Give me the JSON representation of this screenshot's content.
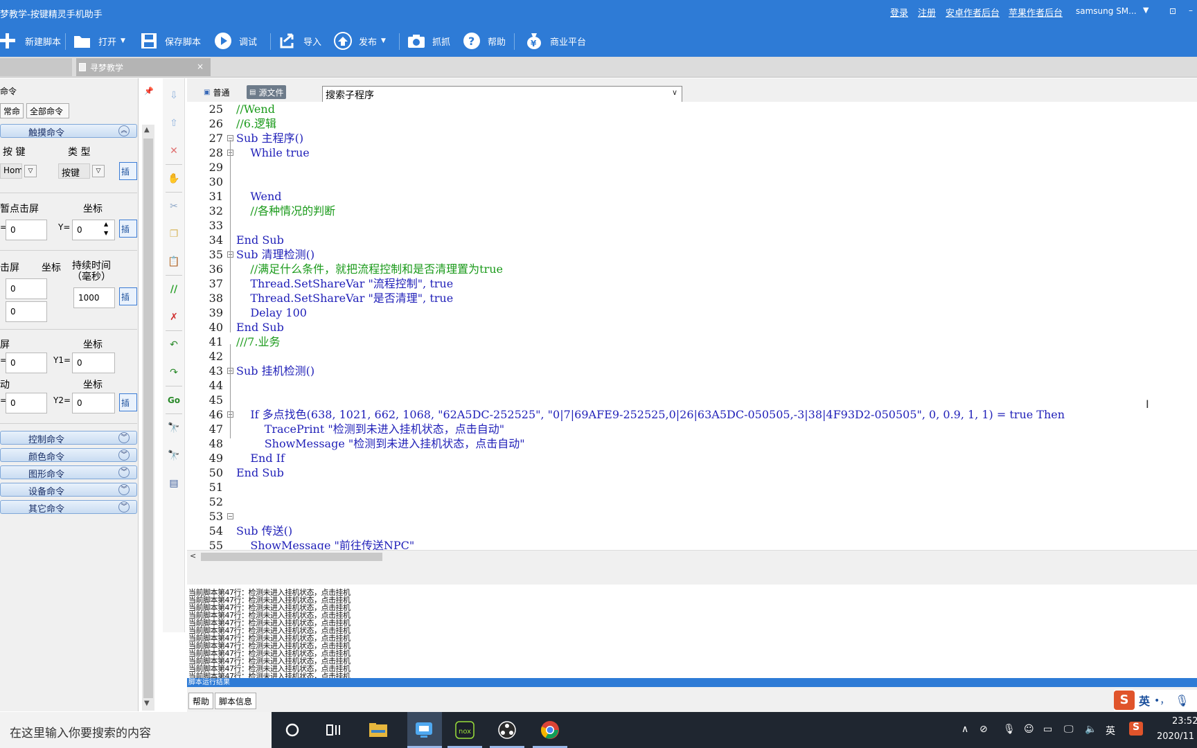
{
  "window": {
    "title": "梦教学-按键精灵手机助手",
    "links": [
      "登录",
      "注册",
      "安卓作者后台",
      "苹果作者后台"
    ],
    "device": "samsung  SM...",
    "win_btn1": "⊡",
    "win_btn2": "–"
  },
  "toolbar": {
    "new_script": "新建脚本",
    "open": "打开",
    "save_script": "保存脚本",
    "debug": "调试",
    "import": "导入",
    "publish": "发布",
    "capture": "抓抓",
    "help": "帮助",
    "business": "商业平台"
  },
  "tabs": {
    "doc_tab": "寻梦教学",
    "doc_close": "×"
  },
  "left_panel": {
    "title": "命令",
    "pin": "📌",
    "tab_common": "常命令",
    "tab_all": "全部命令",
    "touch_cat": "触摸命令",
    "key_label": "按 键",
    "type_label": "类 型",
    "key_value": "Home",
    "type_value": "按键",
    "tap_label": "暂点击屏",
    "coord_label": "坐标",
    "x_value": "0",
    "y_label": "Y=",
    "y_value": "0",
    "press_label": "击屏",
    "press_coord": "坐标",
    "duration_label": "持续时间（毫秒）",
    "press_x": "0",
    "press_y": "0",
    "duration_value": "1000",
    "swipe_label": "屏",
    "swipe_coord": "坐标",
    "swipe_x1": "0",
    "y1_label": "Y1=",
    "swipe_y1": "0",
    "move_label": "动",
    "move_coord": "坐标",
    "swipe_x2": "0",
    "y2_label": "Y2=",
    "swipe_y2": "0",
    "insert_btn": "插",
    "eq": "=",
    "categories": [
      "控制命令",
      "颜色命令",
      "图形命令",
      "设备命令",
      "其它命令"
    ]
  },
  "editor": {
    "mode_normal": "普通",
    "mode_source": "源文件",
    "search_placeholder": "搜索子程序",
    "lines": [
      {
        "n": "25",
        "text": "//Wend"
      },
      {
        "n": "26",
        "text": "//6.逻辑"
      },
      {
        "n": "27",
        "text": "Sub 主程序()"
      },
      {
        "n": "28",
        "text": "    While true"
      },
      {
        "n": "29",
        "text": ""
      },
      {
        "n": "30",
        "text": ""
      },
      {
        "n": "31",
        "text": "    Wend"
      },
      {
        "n": "32",
        "text": "    //各种情况的判断"
      },
      {
        "n": "33",
        "text": ""
      },
      {
        "n": "34",
        "text": "End Sub"
      },
      {
        "n": "35",
        "text": "Sub 清理检测()"
      },
      {
        "n": "36",
        "text": "    //满足什么条件，就把流程控制和是否清理置为true"
      },
      {
        "n": "37",
        "text": "    Thread.SetShareVar \"流程控制\", true"
      },
      {
        "n": "38",
        "text": "    Thread.SetShareVar \"是否清理\", true"
      },
      {
        "n": "39",
        "text": "    Delay 100"
      },
      {
        "n": "40",
        "text": "End Sub"
      },
      {
        "n": "41",
        "text": "///7.业务"
      },
      {
        "n": "42",
        "text": ""
      },
      {
        "n": "43",
        "text": "Sub 挂机检测()"
      },
      {
        "n": "44",
        "text": ""
      },
      {
        "n": "45",
        "text": ""
      },
      {
        "n": "46",
        "text": "    If 多点找色(638, 1021, 662, 1068, \"62A5DC-252525\", \"0|7|69AFE9-252525,0|26|63A5DC-050505,-3|38|4F93D2-050505\", 0, 0.9, 1, 1) = true Then"
      },
      {
        "n": "47",
        "text": "        TracePrint \"检测到未进入挂机状态，点击自动\""
      },
      {
        "n": "48",
        "text": "        ShowMessage \"检测到未进入挂机状态，点击自动\""
      },
      {
        "n": "49",
        "text": "    End If"
      },
      {
        "n": "50",
        "text": "End Sub"
      },
      {
        "n": "51",
        "text": ""
      },
      {
        "n": "52",
        "text": ""
      },
      {
        "n": "53",
        "text": ""
      },
      {
        "n": "54",
        "text": "Sub 传送()"
      },
      {
        "n": "55",
        "text": "    ShowMessage \"前往传送NPC\""
      }
    ]
  },
  "output": {
    "line": "当前脚本第47行：检测未进入挂机状态，点击挂机",
    "status": "脚本运行结果",
    "tab_help": "帮助",
    "tab_info": "脚本信息"
  },
  "ime": {
    "logo": "S",
    "lang": "英",
    "dots": "•，",
    "mic": "🎤"
  },
  "taskbar": {
    "search_placeholder": "在这里输入你要搜索的内容",
    "tray_lang": "英",
    "time": "23:52",
    "date": "2020/11"
  }
}
